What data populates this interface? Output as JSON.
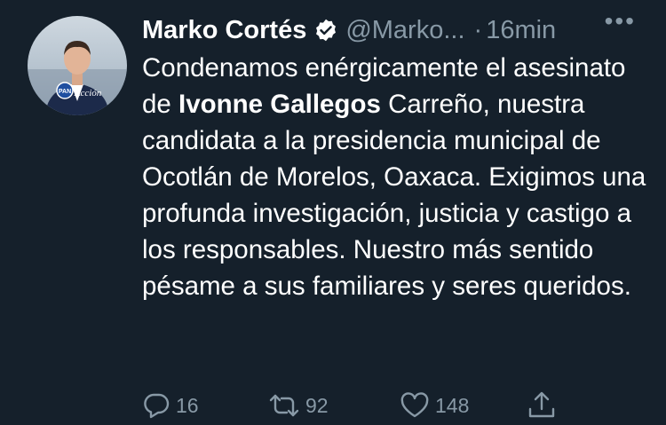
{
  "tweet": {
    "author_name": "Marko Cortés",
    "handle": "@Marko...",
    "separator": "·",
    "timestamp": "16min",
    "more_label": "•••",
    "text_part1": "Condenamos enérgicamente el asesinato de ",
    "text_bold": "Ivonne Gallegos",
    "text_part2": " Carreño, nuestra candidata a la presidencia municipal de Ocotlán de Morelos, Oaxaca. Exigimos una profunda investigación, justicia y castigo a los responsables. Nuestro más sentido pésame a sus familiares y seres queridos.",
    "avatar_badge": "PAN",
    "avatar_caption": "Acción"
  },
  "actions": {
    "reply_count": "16",
    "retweet_count": "92",
    "like_count": "148"
  },
  "colors": {
    "background": "#15202b",
    "text": "#ffffff",
    "secondary": "#8899a6"
  },
  "icons": [
    "verified-badge-icon",
    "more-icon",
    "reply-icon",
    "retweet-icon",
    "like-icon",
    "share-icon"
  ]
}
